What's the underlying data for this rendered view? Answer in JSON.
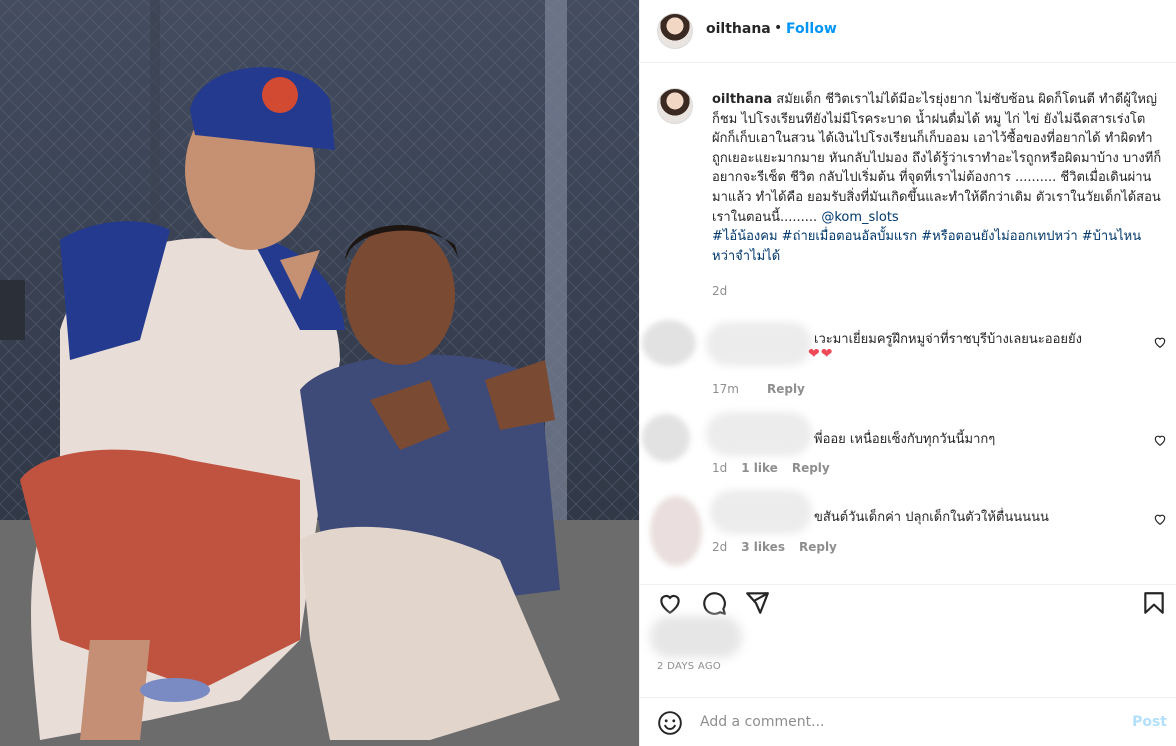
{
  "header": {
    "username": "oilthana",
    "separator": "•",
    "follow_label": "Follow"
  },
  "caption": {
    "username": "oilthana",
    "text": " สมัยเด็ก ชีวิตเราไม่ได้มีอะไรยุ่งยาก ไม่ซับซ้อน ผิดก็โดนตี ทำดีผู้ใหญ่ก็ชม ไปโรงเรียนทียังไม่มีโรคระบาด น้ำฝนดื่มได้ หมู ไก่ ไข่ ยังไม่ฉีดสารเร่งโต ผักก็เก็บเอาในสวน ได้เงินไปโรงเรียนก็เก็บออม เอาไว้ซื้อของที่อยากได้ ทำผิดทำถูกเยอะแยะมากมาย หันกลับไปมอง ถึงได้รู้ว่าเราทำอะไรถูกหรือผิดมาบ้าง บางทีก็อยากจะรีเซ็ต ชีวิต กลับไปเริ่มต้น ที่จุดที่เราไม่ต้องการ .......... ชีวิตเมื่อเดินผ่านมาแล้ว ทำได้คือ ยอมรับสิ่งที่มันเกิดขึ้นและทำให้ดีกว่าเดิม ตัวเราในวัยเด็กได้สอนเราในตอนนี้......... ",
    "mention": "@kom_slots",
    "hashtags": "#ไอ้น้องคม #ถ่ายเมื่อตอนอัลบั้มแรก #หรือตอนยังไม่ออกเทปหว่า #บ้านไหนหว่าจำไม่ได้",
    "age": "2d"
  },
  "comments": [
    {
      "text": "เวะมาเยี่ยมครูฝึกหมูจ่าที่ราชบุรีบ้างเลยนะออยยัง",
      "hearts": "❤❤",
      "age": "17m",
      "likes": "",
      "reply": "Reply"
    },
    {
      "text": "พี่ออย เหนื่อยเซ็งกับทุกวันนี้มากๆ",
      "hearts": "",
      "age": "1d",
      "likes": "1 like",
      "reply": "Reply"
    },
    {
      "text": "ขสันต์วันเด็กค่า ปลุกเด็กในตัวให้ตื่นนนนน",
      "hearts": "",
      "age": "2d",
      "likes": "3 likes",
      "reply": "Reply"
    }
  ],
  "post_meta": {
    "timestamp": "2 DAYS AGO"
  },
  "add_comment": {
    "placeholder": "Add a comment...",
    "post_label": "Post"
  },
  "icons": {
    "like": "heart-icon",
    "comment": "comment-icon",
    "share": "share-icon",
    "save": "bookmark-icon",
    "emoji": "emoji-icon"
  },
  "colors": {
    "accent": "#0095f6",
    "post_disabled": "#b2dffc",
    "heart": "#ed4956",
    "muted": "#8e8e8e",
    "link": "#00376b"
  }
}
